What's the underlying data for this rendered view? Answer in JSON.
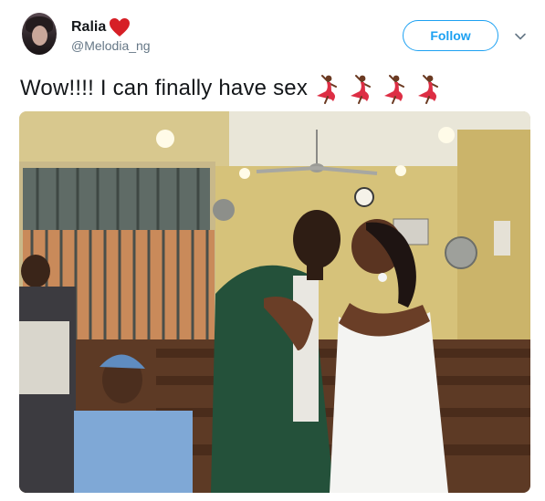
{
  "tweet": {
    "author": {
      "display_name": "Ralia",
      "handle": "@Melodia_ng",
      "name_emoji": "heart-icon"
    },
    "follow_label": "Follow",
    "menu_icon": "chevron-down-icon",
    "text": "Wow!!!! I can finally have sex",
    "text_emojis": [
      "dancer-icon",
      "dancer-icon",
      "dancer-icon",
      "dancer-icon"
    ],
    "media": {
      "type": "photo"
    }
  },
  "colors": {
    "accent": "#1da1f2",
    "secondary_text": "#657786",
    "heart": "#e0245e"
  }
}
